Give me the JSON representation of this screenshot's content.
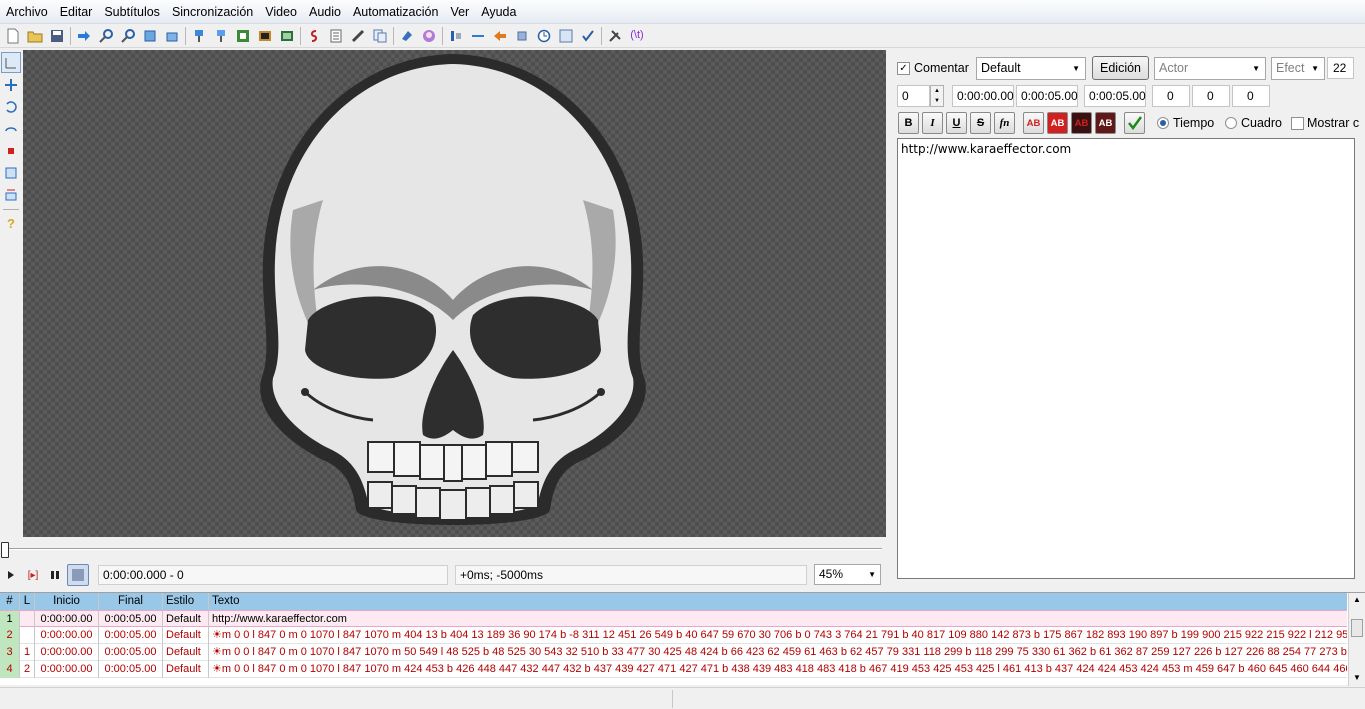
{
  "menu": [
    "Archivo",
    "Editar",
    "Subtítulos",
    "Sincronización",
    "Video",
    "Audio",
    "Automatización",
    "Ver",
    "Ayuda"
  ],
  "toolbar_icons": [
    "new-file-icon",
    "open-folder-icon",
    "save-icon",
    "|",
    "jump-icon",
    "zoom-in-icon",
    "zoom-out-icon",
    "open-video-icon",
    "open-audio-icon",
    "|",
    "style-manager-icon",
    "styles-icon",
    "attachments-icon",
    "fonts-icon",
    "resolution-icon",
    "|",
    "karaoke-icon",
    "properties-icon",
    "spellcheck-icon",
    "find-icon",
    "|",
    "translation-icon",
    "kanji-timer-icon",
    "|",
    "shift-times-icon",
    "snap-icon",
    "timing-post-processor-icon",
    "select-lines-icon",
    "clock-icon",
    "resample-icon",
    "check-icon",
    "|",
    "options-icon",
    "automation-icon"
  ],
  "left_tools": [
    "crosshair-tool-icon",
    "drag-tool-icon",
    "rotate-z-tool-icon",
    "rotate-xy-tool-icon",
    "scale-tool-icon",
    "clip-rect-tool-icon",
    "vector-clip-tool-icon",
    "help-tool-icon"
  ],
  "video": {
    "time_display": "0:00:00.000 - 0",
    "offset_display": "+0ms; -5000ms",
    "zoom": "45%"
  },
  "edit": {
    "comment_label": "Comentar",
    "comment_checked": true,
    "style": "Default",
    "edit_button": "Edición",
    "actor_placeholder": "Actor",
    "effect_placeholder": "Efect",
    "layer_count": "22",
    "layer": "0",
    "start_time": "0:00:00.00",
    "end_time": "0:00:05.00",
    "duration": "0:00:05.00",
    "margin_l": "0",
    "margin_r": "0",
    "margin_v": "0",
    "format_buttons": [
      "B",
      "I",
      "U",
      "S",
      "fn"
    ],
    "color_buttons": [
      "AB",
      "AB",
      "AB",
      "AB"
    ],
    "time_label": "Tiempo",
    "frame_label": "Cuadro",
    "show_label": "Mostrar c",
    "text": "http://www.karaeffector.com"
  },
  "grid": {
    "headers": [
      "#",
      "L",
      "Inicio",
      "Final",
      "Estilo",
      "Texto"
    ],
    "rows": [
      {
        "num": "1",
        "layer": "",
        "start": "0:00:00.00",
        "end": "0:00:05.00",
        "style": "Default",
        "text": "http://www.karaeffector.com"
      },
      {
        "num": "2",
        "layer": "",
        "start": "0:00:00.00",
        "end": "0:00:05.00",
        "style": "Default",
        "text": "☀m 0 0 l 847 0 m 0 1070 l 847 1070 m 404 13 b 404 13 189 36 90 174 b -8 311 12 451 26 549 b 40 647 59 670 30 706 b 0 743 3 764 21 791 b 40 817 109 880 142 873 b 175 867 182 893 190 897 b 199 900 215 922 215 922 l 212 952 l 2"
      },
      {
        "num": "3",
        "layer": "1",
        "start": "0:00:00.00",
        "end": "0:00:05.00",
        "style": "Default",
        "text": "☀m 0 0 l 847 0 m 0 1070 l 847 1070 m 50 549 l 48 525 b 48 525 30 543 32 510 b 33 477 30 425 48 424 b 66 423 62 459 61 463 b 62 457 79 331 118 299 b 118 299 75 330 61 362 b 61 362 87 259 127 226 b 127 226 88 254 77 273 b 77 2"
      },
      {
        "num": "4",
        "layer": "2",
        "start": "0:00:00.00",
        "end": "0:00:05.00",
        "style": "Default",
        "text": "☀m 0 0 l 847 0 m 0 1070 l 847 1070 m 424 453 b 426 448 447 432 447 432 b 437 439 427 471 427 471 b 438 439 483 418 483 418 b 467 419 453 425 453 425 l 461 413 b 437 424 424 453 424 453 m 459 647 b 460 645 460 644 460 642"
      }
    ]
  }
}
